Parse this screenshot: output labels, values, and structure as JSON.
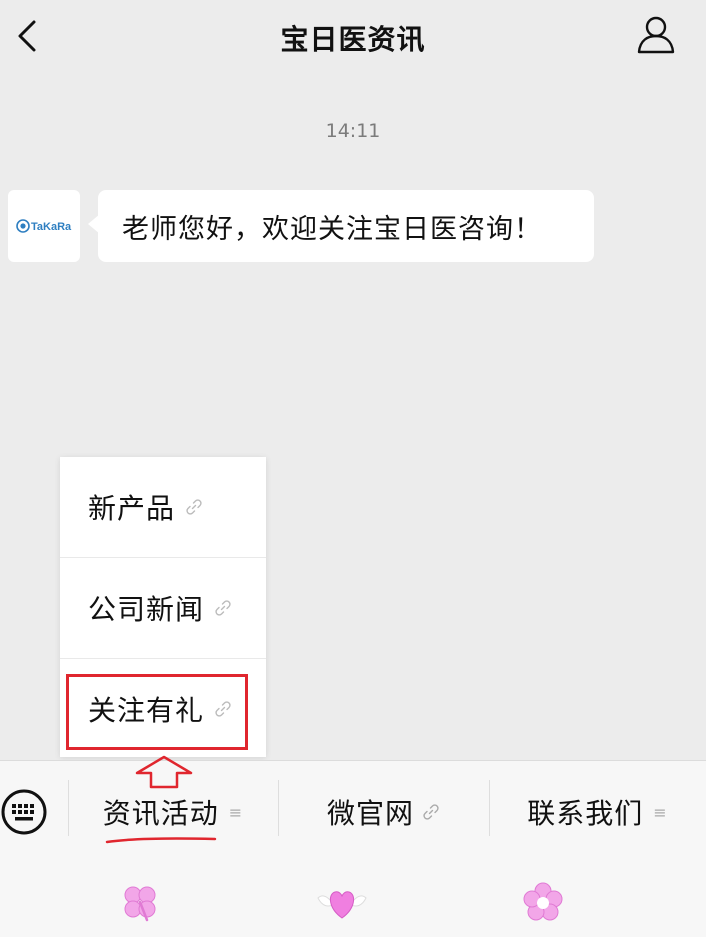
{
  "header": {
    "title": "宝日医资讯",
    "back_icon": "chevron-left-icon",
    "user_icon": "user-icon"
  },
  "chat": {
    "timestamp": "14:11",
    "avatar_text": "TaKaRa",
    "message": "老师您好，欢迎关注宝日医咨询！"
  },
  "popup_menu": {
    "items": [
      {
        "label": "新产品",
        "icon": "link-icon"
      },
      {
        "label": "公司新闻",
        "icon": "link-icon"
      },
      {
        "label": "关注有礼",
        "icon": "link-icon"
      }
    ]
  },
  "menu_bar": {
    "keyboard_icon": "keyboard-icon",
    "items": [
      {
        "label": "资讯活动",
        "icon": "menu-lines-icon",
        "icon_glyph": "≡"
      },
      {
        "label": "微官网",
        "icon": "link-icon"
      },
      {
        "label": "联系我们",
        "icon": "menu-lines-icon",
        "icon_glyph": "≡"
      }
    ]
  },
  "colors": {
    "annotation_red": "#e0262e",
    "background": "#ececec",
    "brand_blue": "#2f7fc1",
    "pink": "#f2a6e8"
  }
}
